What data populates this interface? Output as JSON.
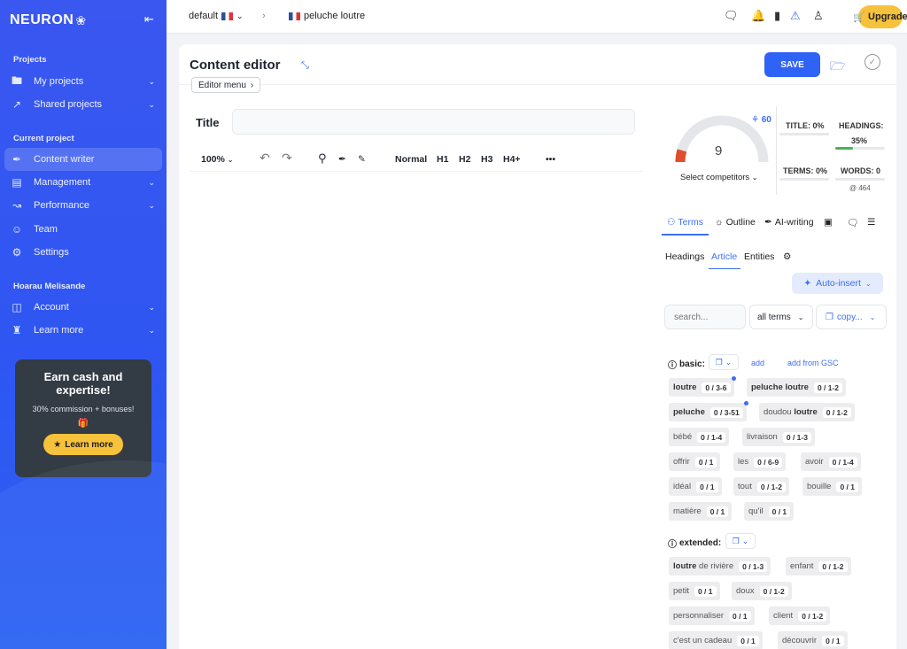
{
  "brand": {
    "name": "NEURON"
  },
  "sidebar": {
    "sections": [
      "Projects",
      "Current project",
      "Hoarau Melisande"
    ],
    "items": [
      {
        "label": "My projects",
        "icon": "folder-icon"
      },
      {
        "label": "Shared projects",
        "icon": "share-icon"
      },
      {
        "label": "Content writer",
        "icon": "feather-icon"
      },
      {
        "label": "Management",
        "icon": "clipboard-icon"
      },
      {
        "label": "Performance",
        "icon": "chart-icon"
      },
      {
        "label": "Team",
        "icon": "team-icon"
      },
      {
        "label": "Settings",
        "icon": "gear-icon"
      },
      {
        "label": "Account",
        "icon": "id-card-icon"
      },
      {
        "label": "Learn more",
        "icon": "learn-icon"
      }
    ],
    "promo": {
      "title": "Earn cash and expertise!",
      "subtitle": "30% commission + bonuses!",
      "button": "Learn more"
    }
  },
  "topbar": {
    "workspace": "default",
    "document": "peluche loutre",
    "upgrade": "Upgrade"
  },
  "editor": {
    "title": "Content editor",
    "menu": "Editor menu",
    "save": "SAVE",
    "title_label": "Title",
    "zoom": "100%",
    "formats": [
      "Normal",
      "H1",
      "H2",
      "H3",
      "H4+"
    ],
    "more": "•••"
  },
  "score": {
    "value": "9",
    "gauge_fraction": 0.09,
    "wifi_value": "60",
    "select": "Select competitors",
    "title": "TITLE: 0%",
    "headings": "HEADINGS:",
    "headings_value": "35%",
    "headings_fraction": 0.35,
    "terms": "TERMS: 0%",
    "words": "WORDS: 0",
    "words_target": "@ 464"
  },
  "tabs": {
    "terms": "Terms",
    "outline": "Outline",
    "ai": "AI-writing"
  },
  "subtabs": [
    "Headings",
    "Article",
    "Entities"
  ],
  "auto_insert": "Auto-insert",
  "filters": {
    "search_placeholder": "search...",
    "select": "all terms",
    "copy": "copy..."
  },
  "basic": {
    "label": "basic:",
    "add": "add",
    "add_gsc": "add from GSC",
    "terms": [
      {
        "bold": "loutre",
        "rest": "",
        "count": "0 / 3-6"
      },
      {
        "bold": "peluche loutre",
        "rest": "",
        "count": "0 / 1-2"
      },
      {
        "bold": "peluche",
        "rest": "",
        "count": "0 / 3-51"
      },
      {
        "pre": "doudou ",
        "bold": "loutre",
        "rest": "",
        "count": "0 / 1-2"
      },
      {
        "bold": "",
        "rest": "bébé",
        "count": "0 / 1-4"
      },
      {
        "bold": "",
        "rest": "livraison",
        "count": "0 / 1-3"
      },
      {
        "bold": "",
        "rest": "offrir",
        "count": "0 / 1"
      },
      {
        "bold": "",
        "rest": "les",
        "count": "0 / 6-9"
      },
      {
        "bold": "",
        "rest": "avoir",
        "count": "0 / 1-4"
      },
      {
        "bold": "",
        "rest": "idéal",
        "count": "0 / 1"
      },
      {
        "bold": "",
        "rest": "tout",
        "count": "0 / 1-2"
      },
      {
        "bold": "",
        "rest": "bouille",
        "count": "0 / 1"
      },
      {
        "bold": "",
        "rest": "matière",
        "count": "0 / 1"
      },
      {
        "bold": "",
        "rest": "qu'il",
        "count": "0 / 1"
      }
    ]
  },
  "extended": {
    "label": "extended:",
    "terms": [
      {
        "bold": "loutre",
        "rest": " de rivière",
        "count": "0 / 1-3"
      },
      {
        "bold": "",
        "rest": "enfant",
        "count": "0 / 1-2"
      },
      {
        "bold": "",
        "rest": "petit",
        "count": "0 / 1"
      },
      {
        "bold": "",
        "rest": "doux",
        "count": "0 / 1-2"
      },
      {
        "bold": "",
        "rest": "personnaliser",
        "count": "0 / 1"
      },
      {
        "bold": "",
        "rest": "client",
        "count": "0 / 1-2"
      },
      {
        "bold": "",
        "rest": "c'est un cadeau",
        "count": "0 / 1"
      },
      {
        "bold": "",
        "rest": "découvrir",
        "count": "0 / 1"
      }
    ]
  },
  "colors": {
    "sidebar": "#3158f1",
    "accent": "#2f63f5",
    "upgrade": "#f7c23b"
  }
}
